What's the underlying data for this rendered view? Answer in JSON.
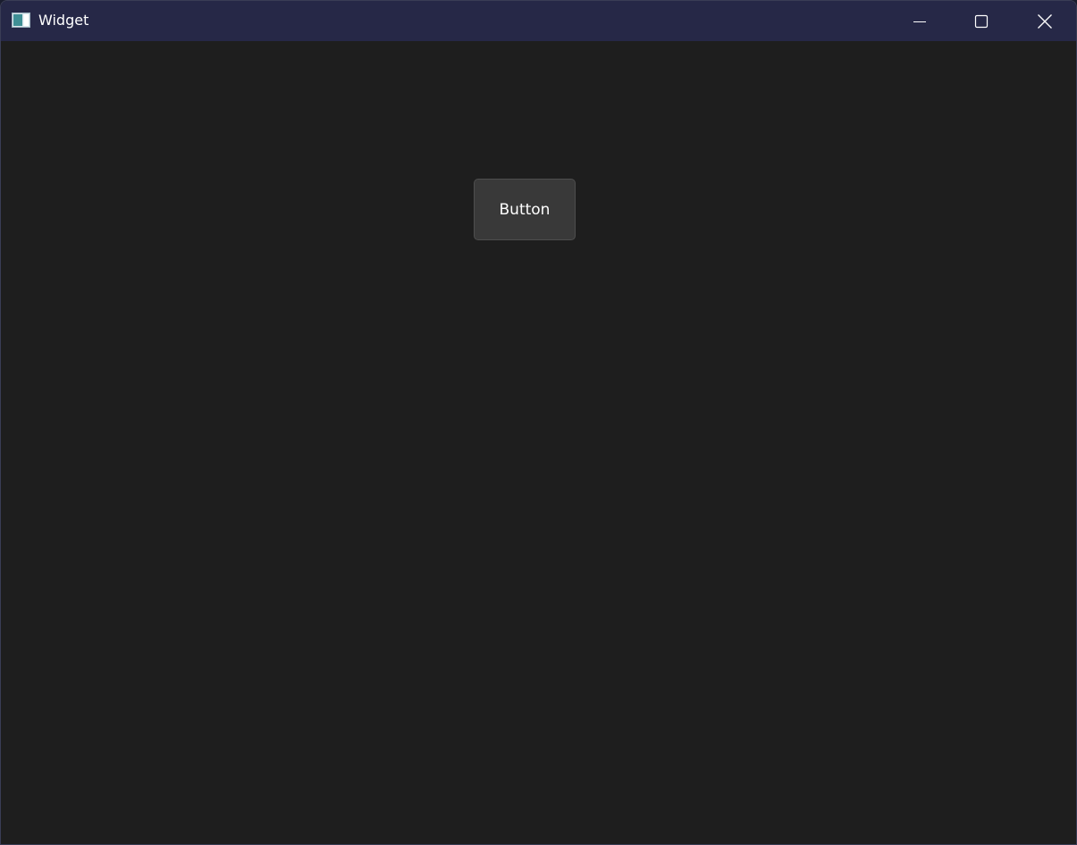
{
  "window": {
    "title": "Widget",
    "icon": "app-window-icon",
    "controls": [
      "minimize-icon",
      "maximize-icon",
      "close-icon"
    ]
  },
  "content": {
    "button_label": "Button"
  },
  "colors": {
    "titlebar": "#262847",
    "client_background": "#1e1e1e",
    "button_background": "#393939",
    "button_border": "#4e4e4e",
    "text": "#ffffff"
  }
}
